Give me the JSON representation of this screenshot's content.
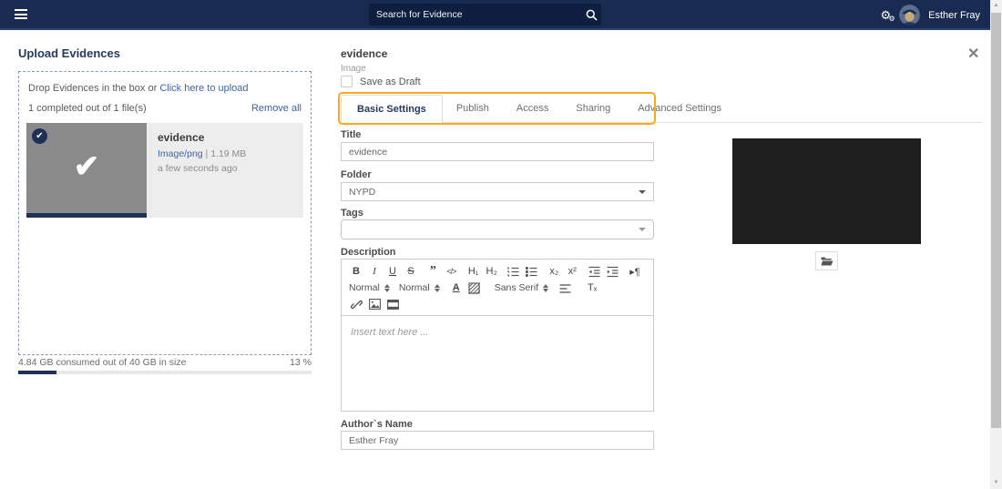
{
  "header": {
    "search": {
      "placeholder": "Search for Evidence"
    },
    "user": {
      "name": "Esther Fray"
    }
  },
  "upload_panel": {
    "title": "Upload Evidences",
    "dropzone_text": "Drop Evidences in the box or ",
    "dropzone_link": "Click here to upload",
    "status_text": "1 completed out of 1 file(s)",
    "remove_all_label": "Remove all",
    "file": {
      "name": "evidence",
      "type": "Image/png",
      "separator": " | ",
      "size": "1.19 MB",
      "time": "a few seconds ago"
    },
    "storage": {
      "text": "4.84 GB consumed out of 40 GB in size",
      "percent_label": "13 %",
      "percent": 13
    }
  },
  "details_panel": {
    "title": "evidence",
    "subtitle": "Image",
    "save_as_draft_label": "Save as Draft",
    "close_glyph": "✕",
    "tabs": [
      {
        "label": "Basic Settings",
        "active": true
      },
      {
        "label": "Publish",
        "active": false
      },
      {
        "label": "Access",
        "active": false
      },
      {
        "label": "Sharing",
        "active": false
      },
      {
        "label": "Advanced Settings",
        "active": false
      }
    ],
    "form": {
      "title_label": "Title",
      "title_value": "evidence",
      "folder_label": "Folder",
      "folder_value": "NYPD",
      "tags_label": "Tags",
      "tags_value": "",
      "description_label": "Description",
      "description_placeholder": "Insert text here ...",
      "author_label": "Author`s Name",
      "author_value": "Esther Fray"
    },
    "editor_toolbar": {
      "bold": "B",
      "italic": "I",
      "underline": "U",
      "strike": "S",
      "blockquote": "”",
      "code": "</>",
      "h1": "H₁",
      "h2": "H₂",
      "subscript": "x₂",
      "superscript": "x²",
      "rtl": "▸¶",
      "size_value": "Normal",
      "header_value": "Normal",
      "color": "A",
      "font_value": "Sans Serif",
      "clean": "Tₓ"
    }
  },
  "icons": {
    "menu": "hamburger",
    "search": "magnifier",
    "gears": "⚙",
    "check": "✔",
    "badge_check": "✔",
    "folder_open": "open-folder"
  },
  "colors": {
    "header_bg": "#1A2B52",
    "search_bg": "#0D1E3E",
    "navy_accent": "#1D3157",
    "link_blue": "#3E64A8",
    "highlight_orange": "#F9A91A",
    "thumbnail_gray": "#8A8A8A",
    "preview_black": "#1E1E1E"
  }
}
